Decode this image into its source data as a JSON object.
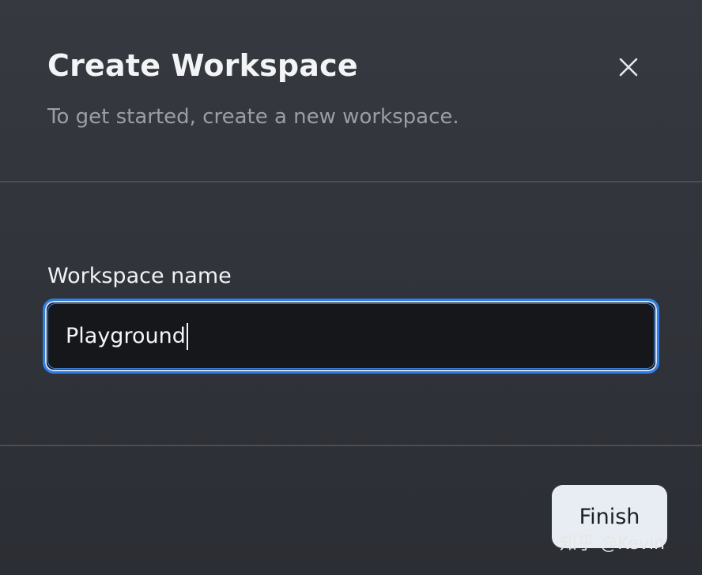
{
  "dialog": {
    "title": "Create Workspace",
    "subtitle": "To get started, create a new workspace.",
    "close_icon": "close-icon"
  },
  "form": {
    "workspace_name_label": "Workspace name",
    "workspace_name_value": "Playground"
  },
  "footer": {
    "finish_label": "Finish"
  },
  "watermark": {
    "text": "知乎 @Kevin"
  },
  "colors": {
    "background": "#30333a",
    "input_focus_border": "#2f7fe6",
    "button_bg": "#e8ecf3"
  }
}
